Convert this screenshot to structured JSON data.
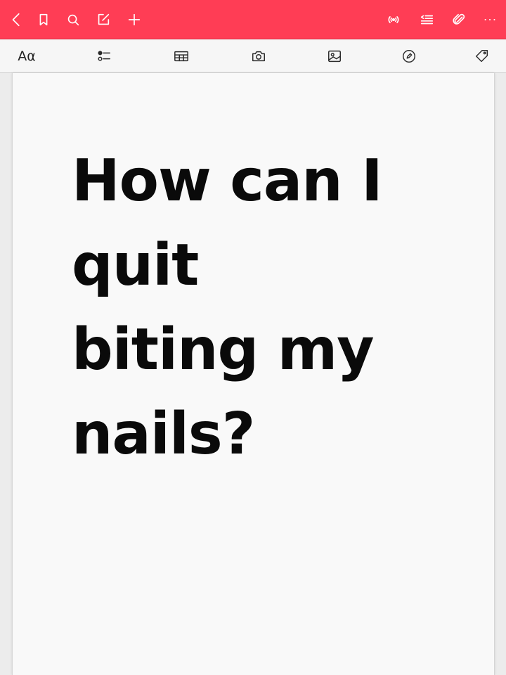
{
  "topbar": {
    "color": "#ff3d55",
    "left_icons": [
      "back-icon",
      "bookmark-icon",
      "search-icon",
      "compose-icon",
      "add-icon"
    ],
    "right_icons": [
      "broadcast-icon",
      "outline-icon",
      "attachment-icon",
      "more-icon"
    ]
  },
  "toolbar": {
    "format_label": "Aα",
    "tools": [
      "text-format-icon",
      "checklist-icon",
      "table-icon",
      "camera-icon",
      "image-icon",
      "pen-icon",
      "tag-icon"
    ]
  },
  "note": {
    "text": "How can I\nquit\nbiting my\nnails?"
  }
}
